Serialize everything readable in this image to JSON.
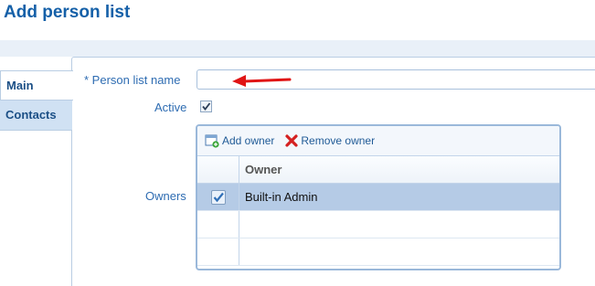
{
  "page": {
    "title": "Add person list"
  },
  "tabs": [
    {
      "label": "Main",
      "active": true
    },
    {
      "label": "Contacts",
      "active": false
    }
  ],
  "form": {
    "name_label": "* Person list name",
    "name_value": "",
    "active_label": "Active",
    "active_checked": true,
    "owners_label": "Owners"
  },
  "owners_grid": {
    "toolbar": {
      "add_label": "Add owner",
      "remove_label": "Remove owner"
    },
    "column_header": "Owner",
    "rows": [
      {
        "owner": "Built-in Admin",
        "checked": true,
        "selected": true
      },
      {
        "owner": "",
        "checked": false,
        "selected": false
      },
      {
        "owner": "",
        "checked": false,
        "selected": false
      }
    ]
  },
  "colors": {
    "title": "#1560a8",
    "label": "#2e6cb2",
    "selected_row": "#b5cbe6",
    "arrow": "#e01515"
  },
  "icons": {
    "add_owner": "add-owner-icon",
    "remove_owner": "remove-owner-icon",
    "active_checkbox": "checkmark-icon",
    "arrow": "red-arrow-annotation"
  }
}
